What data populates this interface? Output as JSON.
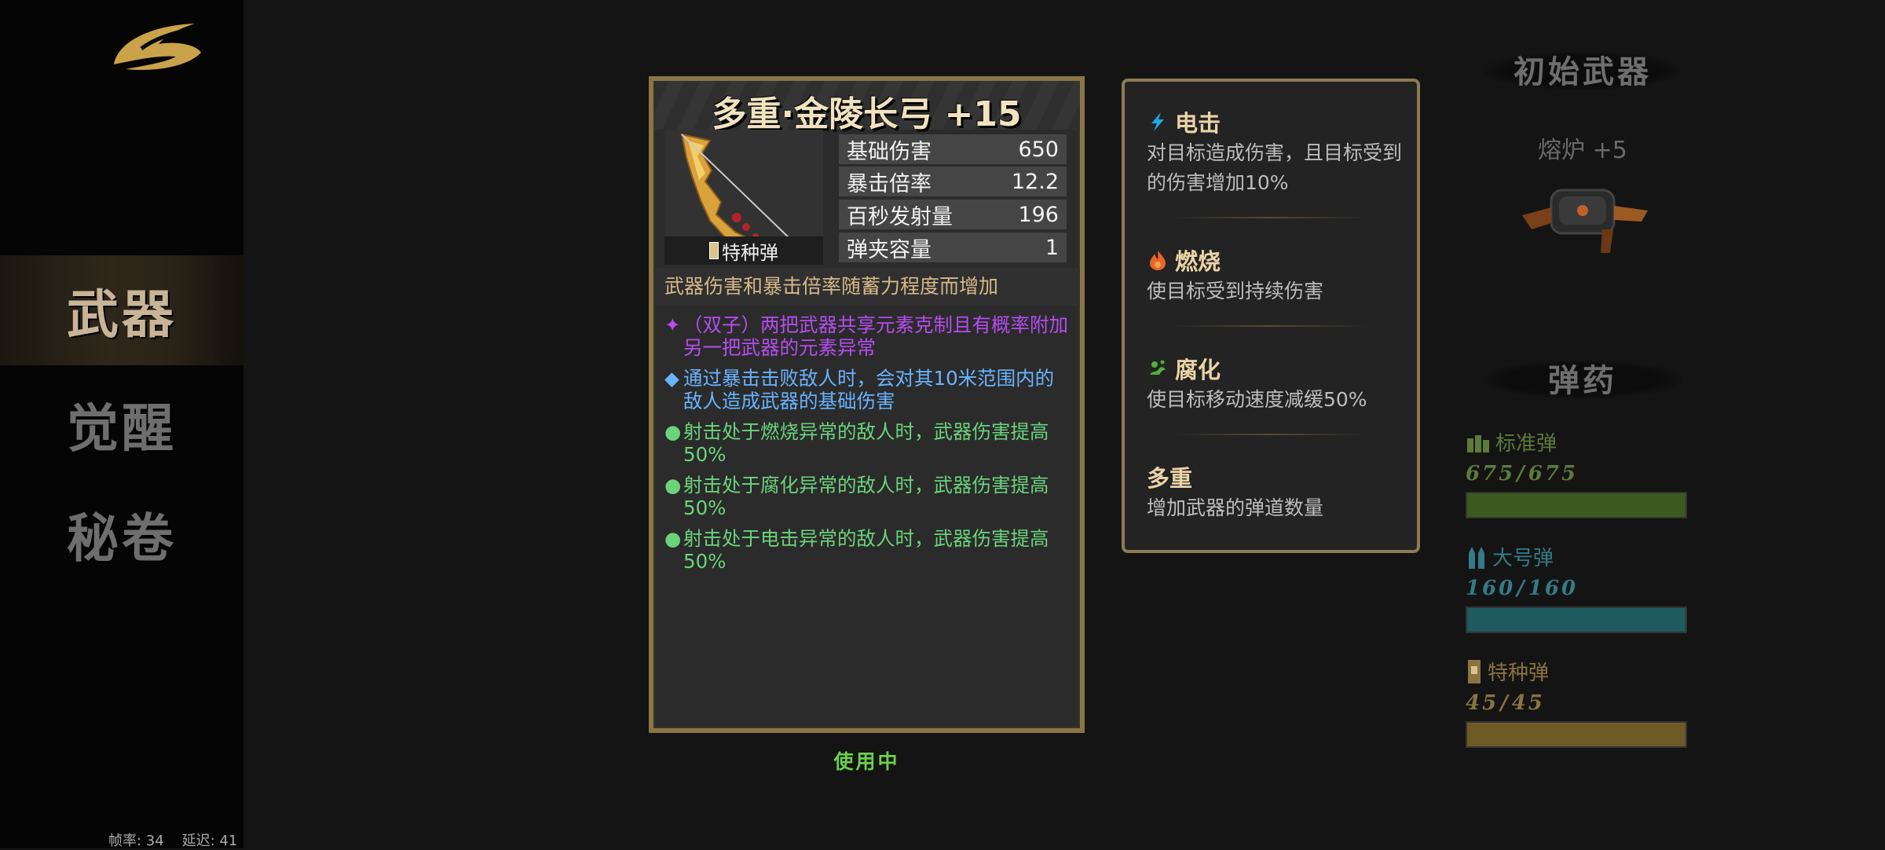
{
  "nav": {
    "items": [
      {
        "label": "武器",
        "active": true
      },
      {
        "label": "觉醒",
        "active": false
      },
      {
        "label": "秘卷",
        "active": false
      }
    ]
  },
  "perf": {
    "text": "帧率: 34    延迟: 41"
  },
  "weapon": {
    "title": "多重·金陵长弓 +15",
    "ammo_type": "特种弹",
    "stats": [
      {
        "label": "基础伤害",
        "value": "650"
      },
      {
        "label": "暴击倍率",
        "value": "12.2"
      },
      {
        "label": "百秒发射量",
        "value": "196"
      },
      {
        "label": "弹夹容量",
        "value": "1"
      }
    ],
    "description": "武器伤害和暴击倍率随蓄力程度而增加",
    "effects": [
      {
        "bullet": "✦",
        "text": "（双子）两把武器共享元素克制且有概率附加另一把武器的元素异常",
        "color": "#b54df0"
      },
      {
        "bullet": "◆",
        "text": "通过暴击击败敌人时，会对其10米范围内的敌人造成武器的基础伤害",
        "color": "#68b4ff"
      },
      {
        "bullet": "●",
        "text": "射击处于燃烧异常的敌人时，武器伤害提高50%",
        "color": "#6ad37b"
      },
      {
        "bullet": "●",
        "text": "射击处于腐化异常的敌人时，武器伤害提高50%",
        "color": "#6ad37b"
      },
      {
        "bullet": "●",
        "text": "射击处于电击异常的敌人时，武器伤害提高50%",
        "color": "#6ad37b"
      }
    ],
    "status": "使用中"
  },
  "elements": [
    {
      "name": "电击",
      "icon": "lightning-icon",
      "color": "#1ea8e6",
      "desc": "对目标造成伤害，且目标受到的伤害增加10%"
    },
    {
      "name": "燃烧",
      "icon": "flame-icon",
      "color": "#e8642a",
      "desc": "使目标受到持续伤害"
    },
    {
      "name": "腐化",
      "icon": "corrosion-icon",
      "color": "#4fb23a",
      "desc": "使目标移动速度减缓50%"
    },
    {
      "name": "多重",
      "icon": "",
      "color": "",
      "desc": "增加武器的弹道数量"
    }
  ],
  "initial_weapon": {
    "title": "初始武器",
    "name": "熔炉 +5"
  },
  "ammo": {
    "title": "弹药",
    "types": [
      {
        "name": "标准弹",
        "current": "675",
        "max": "675",
        "fill": 1.0,
        "color": "#3c5a20",
        "text_color": "#5d7a3a",
        "icon": "standard-ammo-icon"
      },
      {
        "name": "大号弹",
        "current": "160",
        "max": "160",
        "fill": 1.0,
        "color": "#1e5a60",
        "text_color": "#357a86",
        "icon": "large-ammo-icon"
      },
      {
        "name": "特种弹",
        "current": "45",
        "max": "45",
        "fill": 1.0,
        "color": "#6e5a26",
        "text_color": "#8a7440",
        "icon": "special-ammo-icon"
      }
    ]
  }
}
